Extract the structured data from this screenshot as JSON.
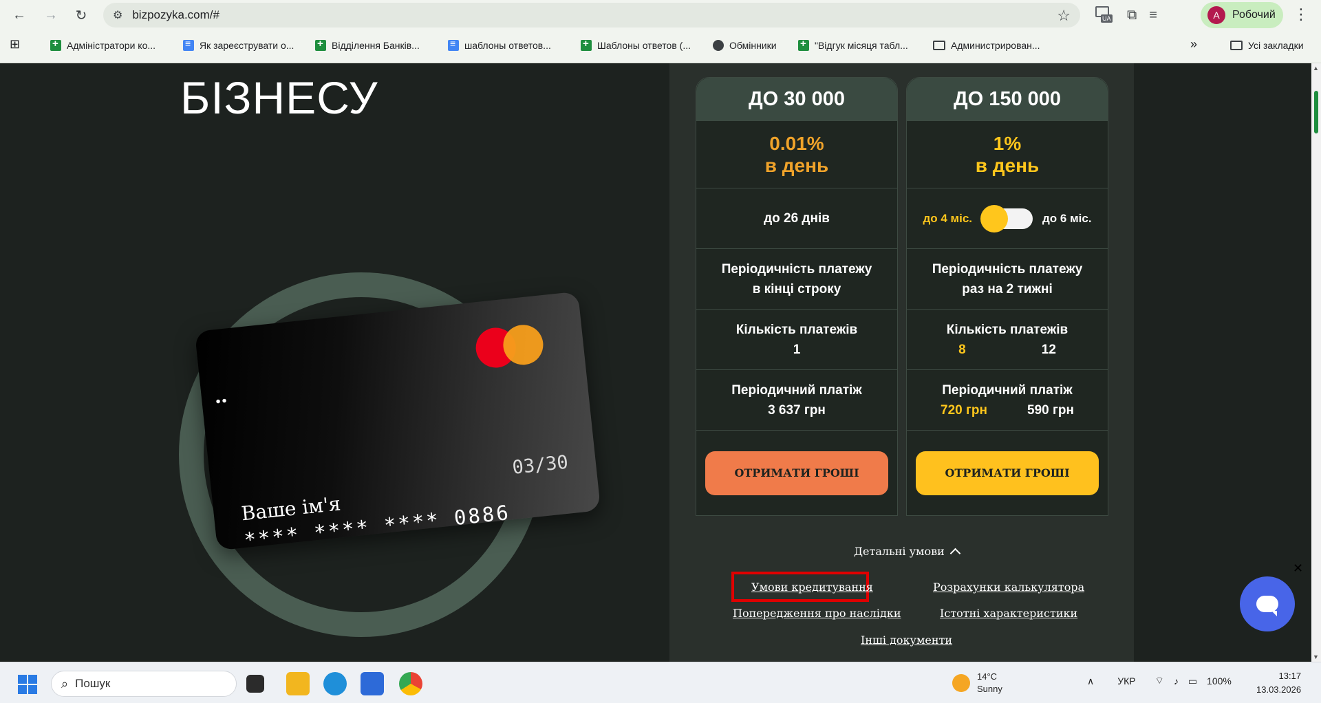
{
  "browser": {
    "url": "bizpozyka.com/#",
    "profile_initial": "A",
    "profile_name": "Робочий",
    "ext_badge": "UA"
  },
  "bookmarks": [
    {
      "label": "Адміністратори ко...",
      "icon": "sheet"
    },
    {
      "label": "Як зареєструвати о...",
      "icon": "doc"
    },
    {
      "label": "Відділення Банків...",
      "icon": "sheet"
    },
    {
      "label": "шаблоны ответов...",
      "icon": "doc"
    },
    {
      "label": "Шаблоны ответов (...",
      "icon": "sheet"
    },
    {
      "label": "Обмінники",
      "icon": "globe"
    },
    {
      "label": "\"Відгук місяця табл...",
      "icon": "sheet"
    },
    {
      "label": "Администрирован...",
      "icon": "folder"
    }
  ],
  "bookmarks_more": "»",
  "bookmarks_all": "Усі закладки",
  "hero": {
    "title": "БІЗНЕСУ"
  },
  "card": {
    "dots": "••",
    "expiry": "03/30",
    "name": "Ваше ім'я",
    "number": "**** **** **** 0886"
  },
  "offers": [
    {
      "head": "ДО 30 000",
      "rate": "0.01%",
      "rate_unit": "в день",
      "term": "до 26 днів",
      "periodicity_label": "Періодичність платежу",
      "periodicity_value": "в кінці строку",
      "count_label": "Кількість платежів",
      "count_value": "1",
      "payment_label": "Періодичний платіж",
      "payment_value": "3 637 грн",
      "button": "ОТРИМАТИ ГРОШІ"
    },
    {
      "head": "ДО 150 000",
      "rate": "1%",
      "rate_unit": "в день",
      "term_left": "до 4 міс.",
      "term_right": "до 6 міс.",
      "periodicity_label": "Періодичність платежу",
      "periodicity_value": "раз на 2 тижні",
      "count_label": "Кількість платежів",
      "count_a": "8",
      "count_b": "12",
      "payment_label": "Періодичний платіж",
      "payment_a": "720 грн",
      "payment_b": "590 грн",
      "button": "ОТРИМАТИ ГРОШІ"
    }
  ],
  "details": {
    "label": "Детальні умови",
    "links": {
      "terms": "Умови кредитування",
      "calc": "Розрахунки калькулятора",
      "warning": "Попередження про наслідки",
      "essential": "Істотні характеристики",
      "other": "Інші документи"
    }
  },
  "chat_close": "✕",
  "taskbar": {
    "search": "Пошук",
    "temp": "14°C",
    "condition": "Sunny",
    "lang": "УКР",
    "battery": "100%",
    "time": "13:17",
    "date": "13.03.2026"
  },
  "colors": {
    "accent_orange": "#f07b4a",
    "accent_yellow": "#ffc11e",
    "panel_dark": "#1f2621",
    "chat_blue": "#4865e8"
  }
}
